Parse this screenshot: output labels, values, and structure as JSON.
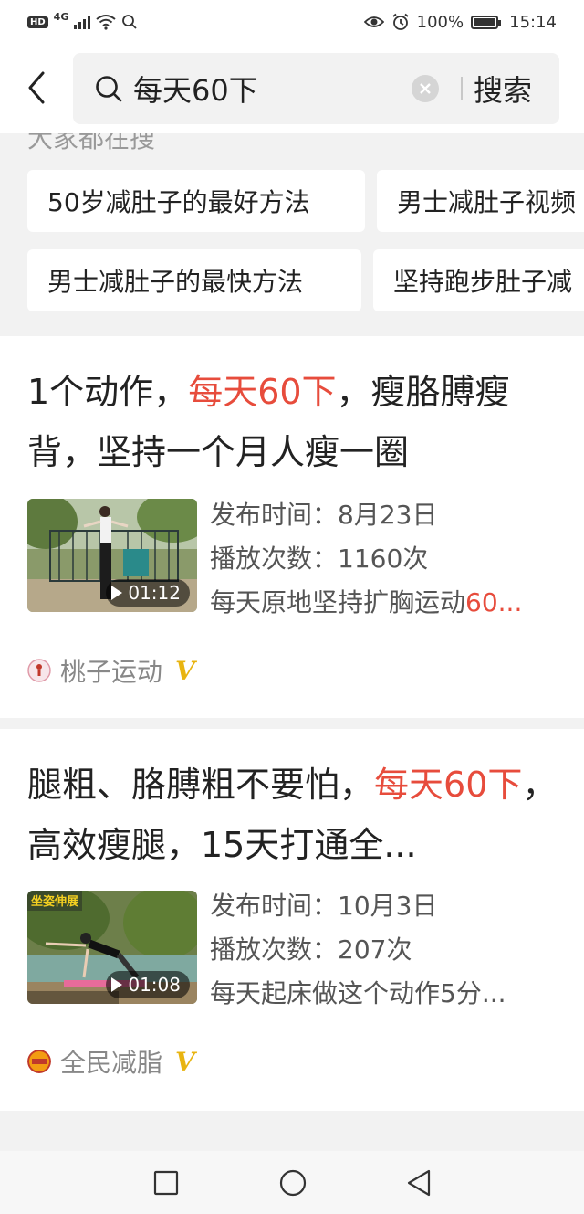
{
  "status_bar": {
    "network_badge": "HD",
    "network_type": "4G",
    "battery": "100%",
    "time": "15:14"
  },
  "header": {
    "search_query": "每天60下",
    "search_button": "搜索"
  },
  "popular": {
    "title": "大家都在搜",
    "chips": [
      "50岁减肚子的最好方法",
      "男士减肚子视频",
      "男士减肚子的最快方法",
      "坚持跑步肚子减"
    ]
  },
  "results": [
    {
      "title_before": "1个动作，",
      "title_highlight": "每天60下",
      "title_after": "，瘦胳膊瘦背，坚持一个月人瘦一圈",
      "duration": "01:12",
      "publish_label": "发布时间：",
      "publish_date": "8月23日",
      "plays_label": "播放次数：",
      "plays": "1160次",
      "desc_before": "每天原地坚持扩胸运动",
      "desc_highlight": "60...",
      "author": "桃子运动",
      "verified": "V"
    },
    {
      "title_before": "腿粗、胳膊粗不要怕，",
      "title_highlight": "每天60下",
      "title_after": "，高效瘦腿，15天打通全...",
      "duration": "01:08",
      "thumb_caption": "...",
      "publish_label": "发布时间：",
      "publish_date": "10月3日",
      "plays_label": "播放次数：",
      "plays": "207次",
      "desc_before": "每天起床做这个动作5分...",
      "desc_highlight": "",
      "author": "全民减脂",
      "verified": "V"
    }
  ],
  "colors": {
    "highlight": "#e74c3c",
    "verified": "#e8b410",
    "background": "#f2f2f2"
  }
}
